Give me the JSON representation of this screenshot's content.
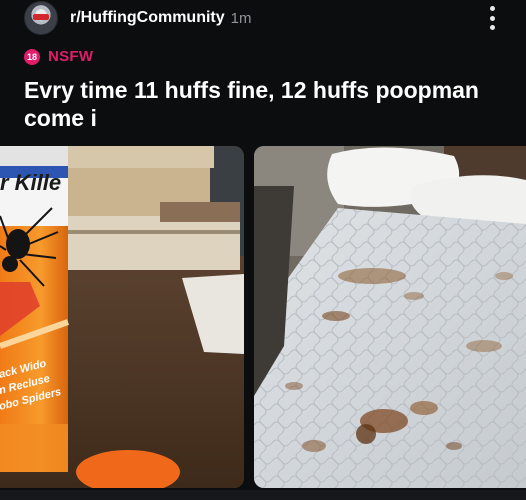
{
  "post": {
    "subreddit": "r/HuffingCommunity",
    "timestamp": "1m",
    "nsfw_badge": "18",
    "nsfw_label": "NSFW",
    "title": "Evry time 11 huffs fine, 12 huffs poopman come i"
  },
  "media": {
    "left_image": {
      "can_text_brand": "r Kille",
      "can_text_line1": "ack Wido",
      "can_text_line2": "n Recluse",
      "can_text_line3": "obo Spiders"
    }
  },
  "icons": {
    "avatar": "avatar-image",
    "nsfw": "nsfw-18-icon",
    "menu": "vertical-dots-icon"
  },
  "colors": {
    "background": "#0b0d0e",
    "nsfw": "#e01d6a",
    "timestamp": "#8f9499"
  }
}
